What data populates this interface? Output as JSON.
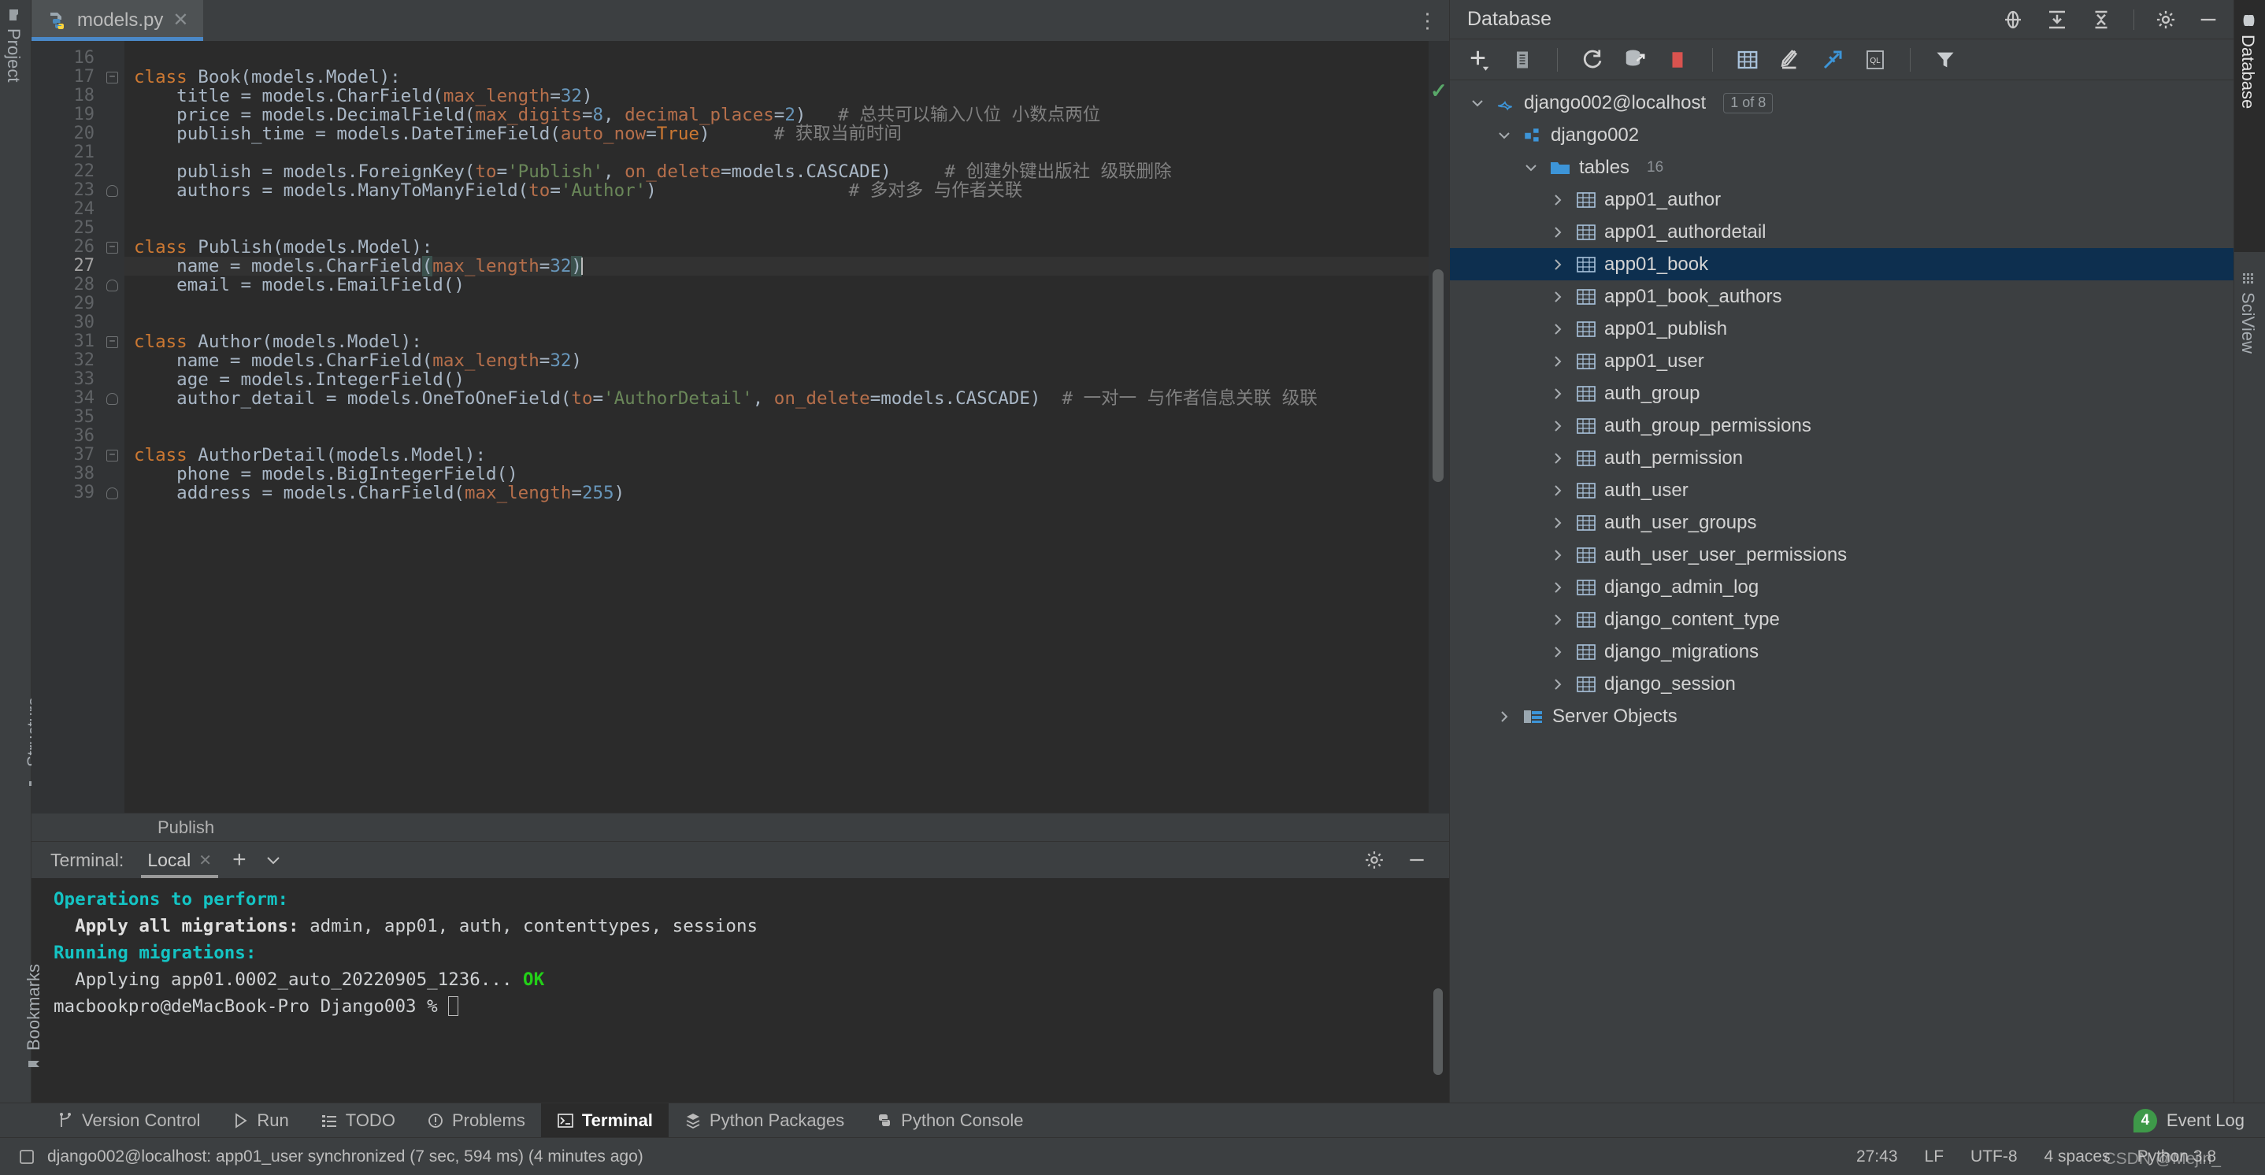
{
  "colors": {
    "accent_blue": "#4a88c7",
    "panel_bg": "#3c3f41",
    "editor_bg": "#2b2b2b",
    "gutter_bg": "#313335",
    "tree_selection": "#0d2f4f",
    "keyword_orange": "#cc7832",
    "param_orange": "#b66f4b",
    "number_blue": "#6897bb",
    "string_green": "#6a8759",
    "comment_gray": "#808080",
    "terminal_cyan": "#14c4c4",
    "terminal_green": "#23d018",
    "badge_green": "#3e9949"
  },
  "left_strip": {
    "items": [
      {
        "label": "Project",
        "icon": "project-icon"
      },
      {
        "label": "Structure",
        "icon": "structure-icon"
      },
      {
        "label": "Bookmarks",
        "icon": "bookmark-icon"
      }
    ]
  },
  "right_strip": {
    "items": [
      {
        "label": "Database",
        "icon": "database-icon",
        "active": true
      },
      {
        "label": "SciView",
        "icon": "sciview-icon",
        "active": false
      }
    ]
  },
  "editor": {
    "tab": {
      "title": "models.py",
      "icon": "python-file-icon",
      "close": "✕"
    },
    "kebab": "⋮",
    "breadcrumb": "Publish",
    "first_line_number": 16,
    "lines": [
      {
        "n": 16,
        "fold": "",
        "tokens": []
      },
      {
        "n": 17,
        "fold": "minus",
        "tokens": [
          {
            "t": "class ",
            "c": "kw"
          },
          {
            "t": "Book(models.Model):",
            "c": "id"
          }
        ]
      },
      {
        "n": 18,
        "fold": "",
        "tokens": [
          {
            "t": "    title = models.CharField(",
            "c": "id"
          },
          {
            "t": "max_length",
            "c": "par"
          },
          {
            "t": "=",
            "c": "id"
          },
          {
            "t": "32",
            "c": "num"
          },
          {
            "t": ")",
            "c": "id"
          }
        ]
      },
      {
        "n": 19,
        "fold": "",
        "tokens": [
          {
            "t": "    price = models.DecimalField(",
            "c": "id"
          },
          {
            "t": "max_digits",
            "c": "par"
          },
          {
            "t": "=",
            "c": "id"
          },
          {
            "t": "8",
            "c": "num"
          },
          {
            "t": ", ",
            "c": "id"
          },
          {
            "t": "decimal_places",
            "c": "par"
          },
          {
            "t": "=",
            "c": "id"
          },
          {
            "t": "2",
            "c": "num"
          },
          {
            "t": ")",
            "c": "id"
          },
          {
            "t": "   # 总共可以输入八位 小数点两位",
            "c": "cmt"
          }
        ]
      },
      {
        "n": 20,
        "fold": "",
        "tokens": [
          {
            "t": "    publish_time = models.DateTimeField(",
            "c": "id"
          },
          {
            "t": "auto_now",
            "c": "par"
          },
          {
            "t": "=",
            "c": "id"
          },
          {
            "t": "True",
            "c": "kw"
          },
          {
            "t": ")",
            "c": "id"
          },
          {
            "t": "      # 获取当前时间",
            "c": "cmt"
          }
        ]
      },
      {
        "n": 21,
        "fold": "",
        "tokens": []
      },
      {
        "n": 22,
        "fold": "",
        "tokens": [
          {
            "t": "    publish = models.ForeignKey(",
            "c": "id"
          },
          {
            "t": "to",
            "c": "par"
          },
          {
            "t": "=",
            "c": "id"
          },
          {
            "t": "'Publish'",
            "c": "str"
          },
          {
            "t": ", ",
            "c": "id"
          },
          {
            "t": "on_delete",
            "c": "par"
          },
          {
            "t": "=",
            "c": "id"
          },
          {
            "t": "models.CASCADE)",
            "c": "id"
          },
          {
            "t": "     # 创建外键出版社 级联删除",
            "c": "cmt"
          }
        ]
      },
      {
        "n": 23,
        "fold": "lock",
        "tokens": [
          {
            "t": "    authors = models.ManyToManyField(",
            "c": "id"
          },
          {
            "t": "to",
            "c": "par"
          },
          {
            "t": "=",
            "c": "id"
          },
          {
            "t": "'Author'",
            "c": "str"
          },
          {
            "t": ")",
            "c": "id"
          },
          {
            "t": "                  # 多对多 与作者关联",
            "c": "cmt"
          }
        ]
      },
      {
        "n": 24,
        "fold": "",
        "tokens": []
      },
      {
        "n": 25,
        "fold": "",
        "tokens": []
      },
      {
        "n": 26,
        "fold": "minus",
        "tokens": [
          {
            "t": "class ",
            "c": "kw"
          },
          {
            "t": "Publish(models.Model):",
            "c": "id"
          }
        ]
      },
      {
        "n": 27,
        "current": true,
        "fold": "",
        "tokens": [
          {
            "t": "    name = models.CharField",
            "c": "id"
          },
          {
            "t": "(",
            "c": "id brk-hl"
          },
          {
            "t": "max_length",
            "c": "par"
          },
          {
            "t": "=",
            "c": "id"
          },
          {
            "t": "32",
            "c": "num"
          },
          {
            "t": ")",
            "c": "id brk-hl"
          },
          {
            "caret": true
          }
        ]
      },
      {
        "n": 28,
        "fold": "lock",
        "tokens": [
          {
            "t": "    email = models.EmailField()",
            "c": "id"
          }
        ]
      },
      {
        "n": 29,
        "fold": "",
        "tokens": []
      },
      {
        "n": 30,
        "fold": "",
        "tokens": []
      },
      {
        "n": 31,
        "fold": "minus",
        "tokens": [
          {
            "t": "class ",
            "c": "kw"
          },
          {
            "t": "Author(models.Model):",
            "c": "id"
          }
        ]
      },
      {
        "n": 32,
        "fold": "",
        "tokens": [
          {
            "t": "    name = models.CharField(",
            "c": "id"
          },
          {
            "t": "max_length",
            "c": "par"
          },
          {
            "t": "=",
            "c": "id"
          },
          {
            "t": "32",
            "c": "num"
          },
          {
            "t": ")",
            "c": "id"
          }
        ]
      },
      {
        "n": 33,
        "fold": "",
        "tokens": [
          {
            "t": "    age = models.IntegerField()",
            "c": "id"
          }
        ]
      },
      {
        "n": 34,
        "fold": "lock",
        "tokens": [
          {
            "t": "    author_detail = models.OneToOneField(",
            "c": "id"
          },
          {
            "t": "to",
            "c": "par"
          },
          {
            "t": "=",
            "c": "id"
          },
          {
            "t": "'AuthorDetail'",
            "c": "str"
          },
          {
            "t": ", ",
            "c": "id"
          },
          {
            "t": "on_delete",
            "c": "par"
          },
          {
            "t": "=",
            "c": "id"
          },
          {
            "t": "models.CASCADE)",
            "c": "id"
          },
          {
            "t": "  # 一对一 与作者信息关联 级联",
            "c": "cmt"
          }
        ]
      },
      {
        "n": 35,
        "fold": "",
        "tokens": []
      },
      {
        "n": 36,
        "fold": "",
        "tokens": []
      },
      {
        "n": 37,
        "fold": "minus",
        "tokens": [
          {
            "t": "class ",
            "c": "kw"
          },
          {
            "t": "AuthorDetail(models.Model):",
            "c": "id"
          }
        ]
      },
      {
        "n": 38,
        "fold": "",
        "tokens": [
          {
            "t": "    phone = models.BigIntegerField()",
            "c": "id"
          }
        ]
      },
      {
        "n": 39,
        "fold": "lock",
        "tokens": [
          {
            "t": "    address = models.CharField(",
            "c": "id"
          },
          {
            "t": "max_length",
            "c": "par"
          },
          {
            "t": "=",
            "c": "id"
          },
          {
            "t": "255",
            "c": "num"
          },
          {
            "t": ")",
            "c": "id"
          }
        ]
      }
    ],
    "inspection_status": "✓"
  },
  "database": {
    "title": "Database",
    "header_icons": [
      {
        "name": "expand-collapse-icon"
      },
      {
        "name": "expand-all-icon"
      },
      {
        "name": "collapse-all-icon"
      },
      {
        "name": "gear-icon"
      },
      {
        "name": "minimize-icon"
      }
    ],
    "toolbar": [
      {
        "name": "add-icon",
        "label": "+"
      },
      {
        "name": "duplicate-icon",
        "label": ""
      },
      {
        "name": "refresh-icon",
        "label": ""
      },
      {
        "name": "sync-db-icon",
        "label": ""
      },
      {
        "name": "stop-icon",
        "label": ""
      },
      {
        "name": "table-editor-icon",
        "label": ""
      },
      {
        "name": "modify-icon",
        "label": ""
      },
      {
        "name": "jump-to-icon",
        "label": ""
      },
      {
        "name": "query-console-icon",
        "label": "QL"
      },
      {
        "name": "filter-icon",
        "label": ""
      }
    ],
    "tree": [
      {
        "level": 0,
        "label": "django002@localhost",
        "icon": "mysql-icon",
        "chev": "down",
        "badge": "1 of 8"
      },
      {
        "level": 1,
        "label": "django002",
        "icon": "schema-icon",
        "chev": "down"
      },
      {
        "level": 2,
        "label": "tables",
        "icon": "folder-icon",
        "chev": "down",
        "count": "16"
      },
      {
        "level": 3,
        "label": "app01_author",
        "icon": "table-icon",
        "chev": "right"
      },
      {
        "level": 3,
        "label": "app01_authordetail",
        "icon": "table-icon",
        "chev": "right"
      },
      {
        "level": 3,
        "label": "app01_book",
        "icon": "table-icon",
        "chev": "right",
        "selected": true
      },
      {
        "level": 3,
        "label": "app01_book_authors",
        "icon": "table-icon",
        "chev": "right"
      },
      {
        "level": 3,
        "label": "app01_publish",
        "icon": "table-icon",
        "chev": "right"
      },
      {
        "level": 3,
        "label": "app01_user",
        "icon": "table-icon",
        "chev": "right"
      },
      {
        "level": 3,
        "label": "auth_group",
        "icon": "table-icon",
        "chev": "right"
      },
      {
        "level": 3,
        "label": "auth_group_permissions",
        "icon": "table-icon",
        "chev": "right"
      },
      {
        "level": 3,
        "label": "auth_permission",
        "icon": "table-icon",
        "chev": "right"
      },
      {
        "level": 3,
        "label": "auth_user",
        "icon": "table-icon",
        "chev": "right"
      },
      {
        "level": 3,
        "label": "auth_user_groups",
        "icon": "table-icon",
        "chev": "right"
      },
      {
        "level": 3,
        "label": "auth_user_user_permissions",
        "icon": "table-icon",
        "chev": "right"
      },
      {
        "level": 3,
        "label": "django_admin_log",
        "icon": "table-icon",
        "chev": "right"
      },
      {
        "level": 3,
        "label": "django_content_type",
        "icon": "table-icon",
        "chev": "right"
      },
      {
        "level": 3,
        "label": "django_migrations",
        "icon": "table-icon",
        "chev": "right"
      },
      {
        "level": 3,
        "label": "django_session",
        "icon": "table-icon",
        "chev": "right"
      },
      {
        "level": 1,
        "label": "Server Objects",
        "icon": "server-objects-icon",
        "chev": "right"
      }
    ]
  },
  "terminal": {
    "label": "Terminal:",
    "tab": "Local",
    "tab_close": "✕",
    "add": "+",
    "chevron": "⌄",
    "gear": "gear-icon",
    "minimize": "minimize-icon",
    "lines": [
      [
        {
          "t": "Operations to perform:",
          "c": "t-cyan"
        }
      ],
      [
        {
          "t": "  Apply all migrations: ",
          "c": "t-bold"
        },
        {
          "t": "admin, app01, auth, contenttypes, sessions",
          "c": "t-white"
        }
      ],
      [
        {
          "t": "Running migrations:",
          "c": "t-cyan"
        }
      ],
      [
        {
          "t": "  Applying app01.0002_auto_20220905_1236... ",
          "c": "t-white"
        },
        {
          "t": "OK",
          "c": "t-green"
        }
      ],
      [
        {
          "t": "macbookpro@deMacBook-Pro Django003 % ",
          "c": "t-white"
        },
        {
          "caret": true
        }
      ]
    ]
  },
  "toolwindow_bar": {
    "items": [
      {
        "label": "Version Control",
        "icon": "branch-icon",
        "active": false
      },
      {
        "label": "Run",
        "icon": "run-icon",
        "active": false
      },
      {
        "label": "TODO",
        "icon": "todo-icon",
        "active": false
      },
      {
        "label": "Problems",
        "icon": "problems-icon",
        "active": false
      },
      {
        "label": "Terminal",
        "icon": "terminal-icon",
        "active": true
      },
      {
        "label": "Python Packages",
        "icon": "packages-icon",
        "active": false
      },
      {
        "label": "Python Console",
        "icon": "python-icon",
        "active": false
      }
    ],
    "event_log": {
      "count": "4",
      "label": "Event Log"
    }
  },
  "statusbar": {
    "message": "django002@localhost: app01_user synchronized (7 sec, 594 ms) (4 minutes ago)",
    "icon": "console-icon",
    "caret_position": "27:43",
    "line_separator": "LF",
    "encoding": "UTF-8",
    "indent": "4 spaces",
    "interpreter": "Python 3.8",
    "watermark": "CSDN @Mejin_"
  }
}
